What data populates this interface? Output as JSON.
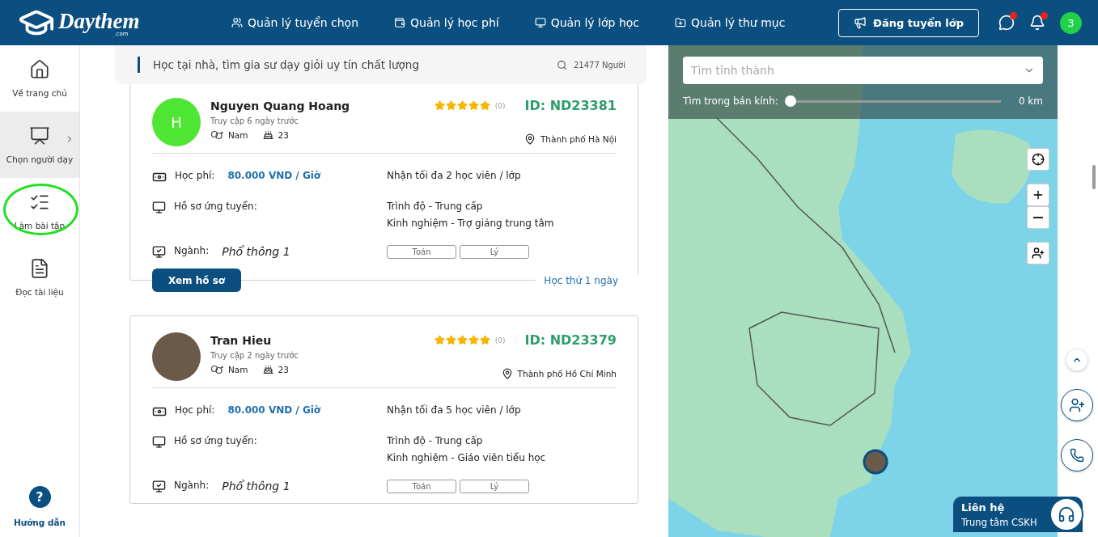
{
  "header": {
    "logo": "Daythem",
    "logo_sub": ".com",
    "nav": [
      {
        "label": "Quản lý tuyển chọn"
      },
      {
        "label": "Quản lý học phí"
      },
      {
        "label": "Quản lý lớp học"
      },
      {
        "label": "Quản lý thư mục"
      }
    ],
    "post_button": "Đăng tuyển lớp",
    "chat_badge": true,
    "bell_badge": true,
    "user_initial": "3"
  },
  "sidebar": {
    "items": [
      {
        "label": "Về trang chủ",
        "selected": false,
        "highlighted": false,
        "has_submenu": false
      },
      {
        "label": "Chọn người dạy",
        "selected": true,
        "highlighted": false,
        "has_submenu": true
      },
      {
        "label": "Làm bài tập",
        "selected": false,
        "highlighted": true,
        "has_submenu": false
      },
      {
        "label": "Đọc tài liệu",
        "selected": false,
        "highlighted": false,
        "has_submenu": false
      }
    ],
    "help_icon": "?",
    "help": "Hướng dẫn"
  },
  "search": {
    "text": "Học tại nhà, tìm gia sư dạy giỏi uy tín chất lượng",
    "count": "21477 Người"
  },
  "tutors": [
    {
      "name": "Nguyen Quang Hoang",
      "initial": "H",
      "last_seen": "Truy cập 6 ngày trước",
      "gender": "Nam",
      "age": "23",
      "stars": 5,
      "reviews": "(0)",
      "id": "ID: ND23381",
      "city": "Thành phố Hà Nội",
      "fee_label": "Học phí:",
      "fee": "80.000 VND / Giờ",
      "capacity": "Nhận tối đa 2 học viên / lớp",
      "profile_label": "Hồ sơ ứng tuyển:",
      "level": "Trình độ - Trung cấp",
      "experience": "Kinh nghiệm - Trợ giảng trung tâm",
      "major_label": "Ngành:",
      "major": "Phổ thông 1",
      "subjects": [
        "Toán",
        "Lý"
      ],
      "view_button": "Xem hồ sơ",
      "trial": "Học thử 1 ngày"
    },
    {
      "name": "Tran Hieu",
      "last_seen": "Truy cập 2 ngày trước",
      "gender": "Nam",
      "age": "23",
      "stars": 5,
      "reviews": "(0)",
      "id": "ID: ND23379",
      "city": "Thành phố Hồ Chí Minh",
      "fee_label": "Học phí:",
      "fee": "80.000 VND / Giờ",
      "capacity": "Nhận tối đa 5 học viên / lớp",
      "profile_label": "Hồ sơ ứng tuyển:",
      "level": "Trình độ - Trung cấp",
      "experience": "Kinh nghiệm - Giáo viên tiểu học",
      "major_label": "Ngành:",
      "major": "Phổ thông 1",
      "subjects": [
        "Toán",
        "Lý"
      ]
    }
  ],
  "map": {
    "province_placeholder": "Tìm tỉnh thành",
    "radius_label": "Tìm trong bán kính:",
    "radius": {
      "level": 0
    },
    "radius_reading": "0 km"
  },
  "contact": {
    "title": "Liên hệ",
    "subtitle": "Trung tâm CSKH"
  }
}
